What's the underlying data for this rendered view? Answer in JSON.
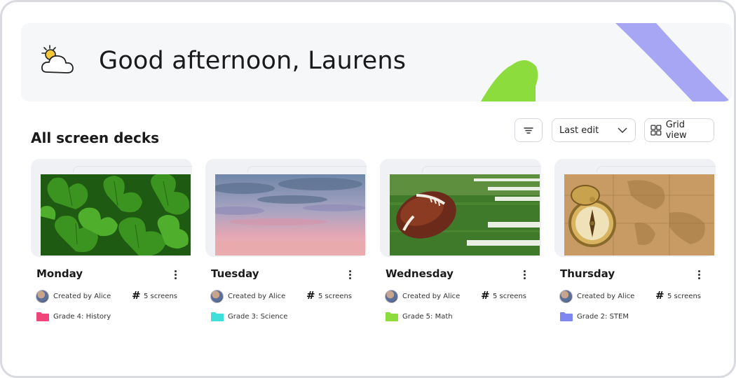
{
  "header": {
    "greeting": "Good afternoon, Laurens",
    "weather_icon": "partly-cloudy-icon",
    "colors": {
      "banner_bg": "#f6f7f9",
      "accent_green": "#8ddc3e",
      "accent_purple": "#a7a6f5"
    }
  },
  "section": {
    "title": "All screen decks"
  },
  "toolbar": {
    "filter_icon": "filter-icon",
    "sort_label": "Last edit",
    "view_label": "Grid view"
  },
  "decks": [
    {
      "name": "Monday",
      "creator": "Created by Alice",
      "screens": "5 screens",
      "folder": "Grade 4: History",
      "folder_color": "#f0457a",
      "thumbnail": "clover-leaves"
    },
    {
      "name": "Tuesday",
      "creator": "Created by Alice",
      "screens": "5 screens",
      "folder": "Grade 3: Science",
      "folder_color": "#3fe0dc",
      "thumbnail": "pink-sky"
    },
    {
      "name": "Wednesday",
      "creator": "Created by Alice",
      "screens": "5 screens",
      "folder": "Grade 5: Math",
      "folder_color": "#8ddc3e",
      "thumbnail": "football-field"
    },
    {
      "name": "Thursday",
      "creator": "Created by Alice",
      "screens": "5 screens",
      "folder": "Grade 2: STEM",
      "folder_color": "#7f86f0",
      "thumbnail": "compass-map"
    }
  ]
}
